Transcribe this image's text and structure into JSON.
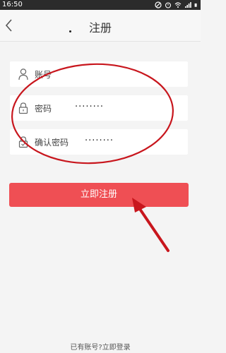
{
  "status_bar": {
    "time": "16:50"
  },
  "header": {
    "title": "注册"
  },
  "form": {
    "account": {
      "label": "账号"
    },
    "password": {
      "label": "密码",
      "value": "········"
    },
    "confirm_password": {
      "label": "确认密码",
      "value": "········"
    }
  },
  "register_button": {
    "label": "立即注册"
  },
  "footer": {
    "login_link": "已有账号?立即登录"
  },
  "colors": {
    "primary_red": "#ef4f54",
    "background": "#f4f4f4",
    "annotation": "#c8161d"
  }
}
